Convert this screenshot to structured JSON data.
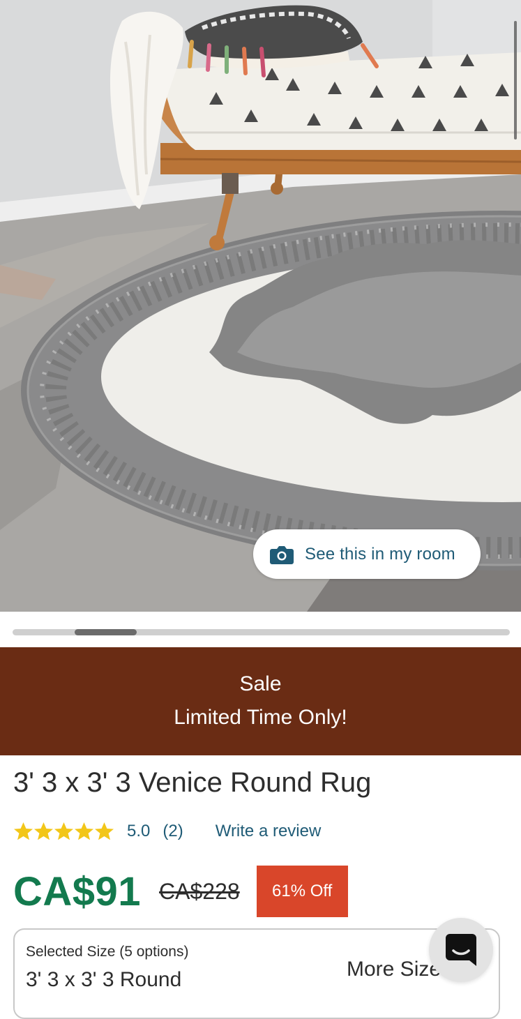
{
  "hero": {
    "image_alt": "Round grey and ivory rug under a rattan daybed",
    "room_button_label": "See this in my room",
    "room_button_icon": "camera-icon",
    "carousel_progress": {
      "total_slides": 8,
      "current_slide": 2
    }
  },
  "sale_banner": {
    "line1": "Sale",
    "line2": "Limited Time Only!",
    "background": "#6a2c14"
  },
  "product": {
    "title": "3' 3 x 3' 3 Venice Round Rug",
    "rating": {
      "stars_filled": 5,
      "stars_total": 5,
      "value": "5.0",
      "count": "(2)",
      "write_review": "Write a review",
      "star_color": "#f2c619"
    },
    "price": {
      "current": "CA$91",
      "original": "CA$228",
      "discount": "61% Off",
      "current_color": "#137a4e",
      "badge_color": "#d9462a"
    },
    "size_selector": {
      "caption": "Selected Size (5 options)",
      "value": "3' 3 x 3' 3 Round",
      "more_label": "More Sizes"
    }
  },
  "chat": {
    "icon": "chat-bubble-icon"
  },
  "colors": {
    "link": "#1f5b76"
  }
}
